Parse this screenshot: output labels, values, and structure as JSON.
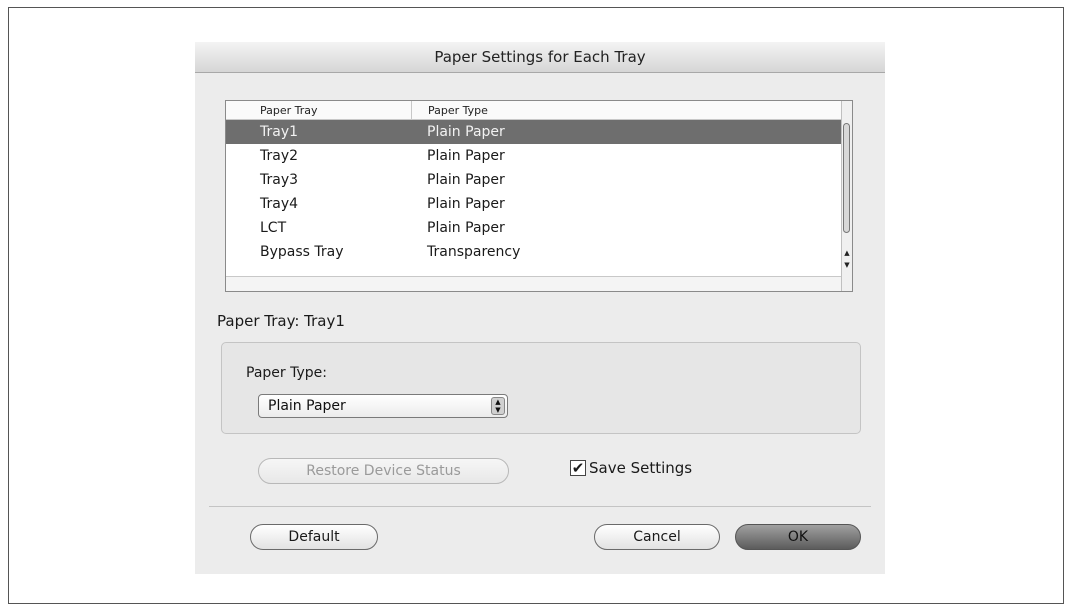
{
  "dialog": {
    "title": "Paper Settings for Each Tray"
  },
  "table": {
    "headers": [
      "Paper Tray",
      "Paper Type"
    ],
    "rows": [
      {
        "tray": "Tray1",
        "type": "Plain Paper"
      },
      {
        "tray": "Tray2",
        "type": "Plain Paper"
      },
      {
        "tray": "Tray3",
        "type": "Plain Paper"
      },
      {
        "tray": "Tray4",
        "type": "Plain Paper"
      },
      {
        "tray": "LCT",
        "type": "Plain Paper"
      },
      {
        "tray": "Bypass Tray",
        "type": "Transparency"
      }
    ],
    "selected_index": 0
  },
  "selected_tray_label": "Paper Tray: Tray1",
  "paper_type": {
    "label": "Paper Type:",
    "value": "Plain Paper"
  },
  "buttons": {
    "restore": "Restore Device Status",
    "default": "Default",
    "cancel": "Cancel",
    "ok": "OK"
  },
  "save_settings": {
    "label": "Save Settings",
    "checked": true
  }
}
